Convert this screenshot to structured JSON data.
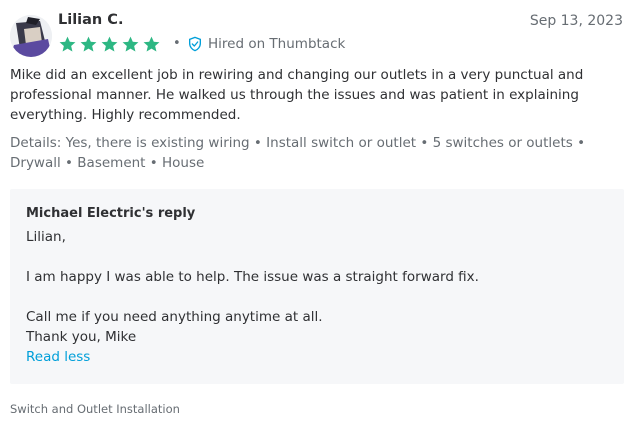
{
  "review": {
    "reviewer_name": "Lilian C.",
    "date": "Sep 13, 2023",
    "rating": 5,
    "star_color": "#2db783",
    "separator": "•",
    "hired_label": "Hired on Thumbtack",
    "hired_icon": "shield-check-icon",
    "text": "Mike did an excellent job in rewiring and changing our outlets in a very punctual and professional manner. He walked us through the issues and was patient in explaining everything. Highly recommended.",
    "details": "Details: Yes, there is existing wiring • Install switch or outlet • 5 switches or outlets • Drywall • Basement • House"
  },
  "reply": {
    "title": "Michael Electric's reply",
    "lines": [
      "Lilian,",
      "I am happy I was able to help. The issue was a straight forward fix.",
      "Call me if you need anything anytime at all.",
      "Thank you, Mike"
    ],
    "read_less_label": "Read less",
    "link_color": "#009fd9"
  },
  "footer": {
    "service_tag": "Switch and Outlet Installation"
  }
}
